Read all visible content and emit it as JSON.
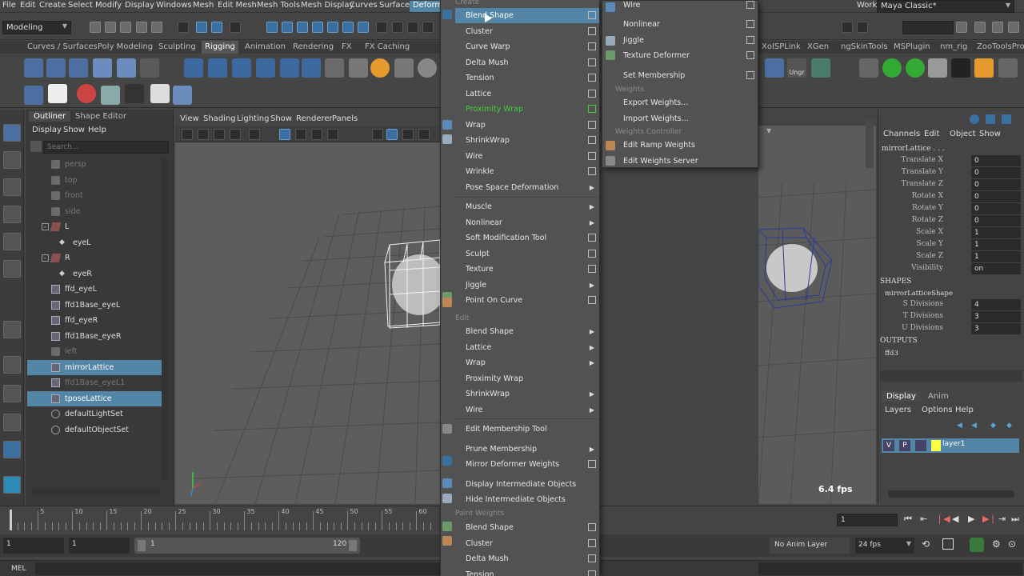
{
  "menubar": {
    "items": [
      "File",
      "Edit",
      "Create",
      "Select",
      "Modify",
      "Display",
      "Windows",
      "Mesh",
      "Edit Mesh",
      "Mesh Tools",
      "Mesh Display",
      "Curves",
      "Surfaces",
      "Deform"
    ],
    "workspace_label": "Workspace :",
    "workspace_value": "Maya Classic*"
  },
  "statusline": {
    "mode": "Modeling"
  },
  "shelf": {
    "tabs": [
      "Curves / Surfaces",
      "Poly Modeling",
      "Sculpting",
      "Rigging",
      "Animation",
      "Rendering",
      "FX",
      "FX Caching"
    ],
    "active_tab": "Rigging",
    "right_tabs": [
      "XoISPLink",
      "XGen",
      "ngSkinTools",
      "MSPlugin",
      "nm_rig",
      "ZooToolsPro"
    ],
    "ungr_label": "Ungr"
  },
  "outliner": {
    "tabs": [
      "Outliner",
      "Shape Editor"
    ],
    "menu": [
      "Display",
      "Show",
      "Help"
    ],
    "search_placeholder": "Search...",
    "rows": [
      {
        "label": "persp",
        "icon": "camera-icon",
        "dim": true,
        "selected": false,
        "indent": 1
      },
      {
        "label": "top",
        "icon": "camera-icon",
        "dim": true,
        "selected": false,
        "indent": 1
      },
      {
        "label": "front",
        "icon": "camera-icon",
        "dim": true,
        "selected": false,
        "indent": 1
      },
      {
        "label": "side",
        "icon": "camera-icon",
        "dim": true,
        "selected": false,
        "indent": 1
      },
      {
        "label": "L",
        "icon": "group-icon",
        "dim": false,
        "selected": false,
        "indent": 1,
        "expand": "-"
      },
      {
        "label": "eyeL",
        "icon": "mesh-icon",
        "dim": false,
        "selected": false,
        "indent": 2
      },
      {
        "label": "R",
        "icon": "group-icon",
        "dim": false,
        "selected": false,
        "indent": 1,
        "expand": "-"
      },
      {
        "label": "eyeR",
        "icon": "mesh-icon",
        "dim": false,
        "selected": false,
        "indent": 2
      },
      {
        "label": "ffd_eyeL",
        "icon": "lattice-icon",
        "dim": false,
        "selected": false,
        "indent": 1
      },
      {
        "label": "ffd1Base_eyeL",
        "icon": "lattice-icon",
        "dim": false,
        "selected": false,
        "indent": 1
      },
      {
        "label": "ffd_eyeR",
        "icon": "lattice-icon",
        "dim": false,
        "selected": false,
        "indent": 1
      },
      {
        "label": "ffd1Base_eyeR",
        "icon": "lattice-icon",
        "dim": false,
        "selected": false,
        "indent": 1
      },
      {
        "label": "left",
        "icon": "camera-icon",
        "dim": true,
        "selected": false,
        "indent": 1
      },
      {
        "label": "mirrorLattice",
        "icon": "lattice-icon",
        "dim": false,
        "selected": true,
        "indent": 1
      },
      {
        "label": "ffd1Base_eyeL1",
        "icon": "lattice-icon",
        "dim": true,
        "selected": false,
        "indent": 1
      },
      {
        "label": "tposeLattice",
        "icon": "lattice-icon",
        "dim": false,
        "selected": true,
        "indent": 1
      },
      {
        "label": "defaultLightSet",
        "icon": "set-icon",
        "dim": false,
        "selected": false,
        "indent": 1
      },
      {
        "label": "defaultObjectSet",
        "icon": "set-icon",
        "dim": false,
        "selected": false,
        "indent": 1
      }
    ]
  },
  "viewport": {
    "menu": [
      "View",
      "Shading",
      "Lighting",
      "Show",
      "Renderer",
      "Panels"
    ],
    "fps": "6.4 fps"
  },
  "deform_menu": {
    "section_create": "Create",
    "create_items": [
      {
        "label": "Blend Shape",
        "opt": true,
        "sub": false,
        "hl": true
      },
      {
        "label": "Cluster",
        "opt": true,
        "sub": false
      },
      {
        "label": "Curve Warp",
        "opt": true,
        "sub": false
      },
      {
        "label": "Delta Mush",
        "opt": true,
        "sub": false
      },
      {
        "label": "Tension",
        "opt": true,
        "sub": false
      },
      {
        "label": "Lattice",
        "opt": true,
        "sub": false
      },
      {
        "label": "Proximity Wrap",
        "opt": true,
        "sub": false,
        "green": true
      },
      {
        "label": "Wrap",
        "opt": true,
        "sub": false
      },
      {
        "label": "ShrinkWrap",
        "opt": true,
        "sub": false
      },
      {
        "label": "Wire",
        "opt": true,
        "sub": false
      },
      {
        "label": "Wrinkle",
        "opt": true,
        "sub": false
      },
      {
        "label": "Pose Space Deformation",
        "opt": false,
        "sub": true
      }
    ],
    "mid_items": [
      {
        "label": "Muscle",
        "opt": false,
        "sub": true
      },
      {
        "label": "Nonlinear",
        "opt": false,
        "sub": true
      },
      {
        "label": "Soft Modification Tool",
        "opt": true,
        "sub": false
      },
      {
        "label": "Sculpt",
        "opt": true,
        "sub": false
      },
      {
        "label": "Texture",
        "opt": true,
        "sub": false
      },
      {
        "label": "Jiggle",
        "opt": false,
        "sub": true
      },
      {
        "label": "Point On Curve",
        "opt": true,
        "sub": false
      }
    ],
    "section_edit": "Edit",
    "edit_items": [
      {
        "label": "Blend Shape",
        "opt": false,
        "sub": true
      },
      {
        "label": "Lattice",
        "opt": false,
        "sub": true
      },
      {
        "label": "Wrap",
        "opt": false,
        "sub": true
      },
      {
        "label": "Proximity Wrap",
        "opt": false,
        "sub": false
      },
      {
        "label": "ShrinkWrap",
        "opt": false,
        "sub": true
      },
      {
        "label": "Wire",
        "opt": false,
        "sub": true
      }
    ],
    "membership_items": [
      {
        "label": "Edit Membership Tool",
        "opt": false,
        "sub": false
      },
      {
        "label": "Prune Membership",
        "opt": false,
        "sub": true
      },
      {
        "label": "Mirror Deformer Weights",
        "opt": true,
        "sub": false
      },
      {
        "label": "Display Intermediate Objects",
        "opt": false,
        "sub": false
      },
      {
        "label": "Hide Intermediate Objects",
        "opt": false,
        "sub": false
      }
    ],
    "section_paint": "Paint Weights",
    "paint_items": [
      {
        "label": "Blend Shape",
        "opt": true,
        "sub": false
      },
      {
        "label": "Cluster",
        "opt": true,
        "sub": false
      },
      {
        "label": "Delta Mush",
        "opt": true,
        "sub": false
      },
      {
        "label": "Tension",
        "opt": true,
        "sub": false
      }
    ]
  },
  "submenu": {
    "items_top": [
      {
        "label": "Wire",
        "opt": true
      },
      {
        "label": "Nonlinear",
        "opt": true
      },
      {
        "label": "Jiggle",
        "opt": true
      },
      {
        "label": "Texture Deformer",
        "opt": true
      },
      {
        "label": "Set Membership",
        "opt": true
      }
    ],
    "section_weights": "Weights",
    "weights_items": [
      {
        "label": "Export Weights..."
      },
      {
        "label": "Import Weights..."
      }
    ],
    "section_controller": "Weights Controller",
    "controller_items": [
      {
        "label": "Edit Ramp Weights"
      },
      {
        "label": "Edit Weights Server"
      }
    ]
  },
  "channelbox": {
    "menu": [
      "Channels",
      "Edit",
      "Object",
      "Show"
    ],
    "object_name": "mirrorLattice . . .",
    "attrs": [
      {
        "label": "Translate X",
        "value": "0"
      },
      {
        "label": "Translate Y",
        "value": "0"
      },
      {
        "label": "Translate Z",
        "value": "0"
      },
      {
        "label": "Rotate X",
        "value": "0"
      },
      {
        "label": "Rotate Y",
        "value": "0"
      },
      {
        "label": "Rotate Z",
        "value": "0"
      },
      {
        "label": "Scale X",
        "value": "1"
      },
      {
        "label": "Scale Y",
        "value": "1"
      },
      {
        "label": "Scale Z",
        "value": "1"
      },
      {
        "label": "Visibility",
        "value": "on"
      }
    ],
    "shapes_label": "SHAPES",
    "shape_name": "mirrorLatticeShape",
    "shape_attrs": [
      {
        "label": "S Divisions",
        "value": "4"
      },
      {
        "label": "T Divisions",
        "value": "3"
      },
      {
        "label": "U Divisions",
        "value": "3"
      }
    ],
    "outputs_label": "OUTPUTS",
    "output_name": "ffd3"
  },
  "layers": {
    "tabs": [
      "Display",
      "Anim"
    ],
    "menu": [
      "Layers",
      "Options",
      "Help"
    ],
    "layer_v": "V",
    "layer_p": "P",
    "layer_name": "layer1"
  },
  "timeline": {
    "ticks": [
      "5",
      "10",
      "15",
      "20",
      "25",
      "30",
      "35",
      "40",
      "45",
      "50",
      "55",
      "60"
    ],
    "current_frame": "1"
  },
  "range": {
    "start": "1",
    "playback_start": "1",
    "slider_start": "1",
    "slider_end": "120",
    "anim_layer": "No Anim Layer",
    "fps": "24 fps"
  },
  "cmdline": {
    "label": "MEL"
  },
  "colors": {
    "highlight": "#5285a6",
    "green": "#3ad33a",
    "layer_yellow": "#ffff44"
  }
}
